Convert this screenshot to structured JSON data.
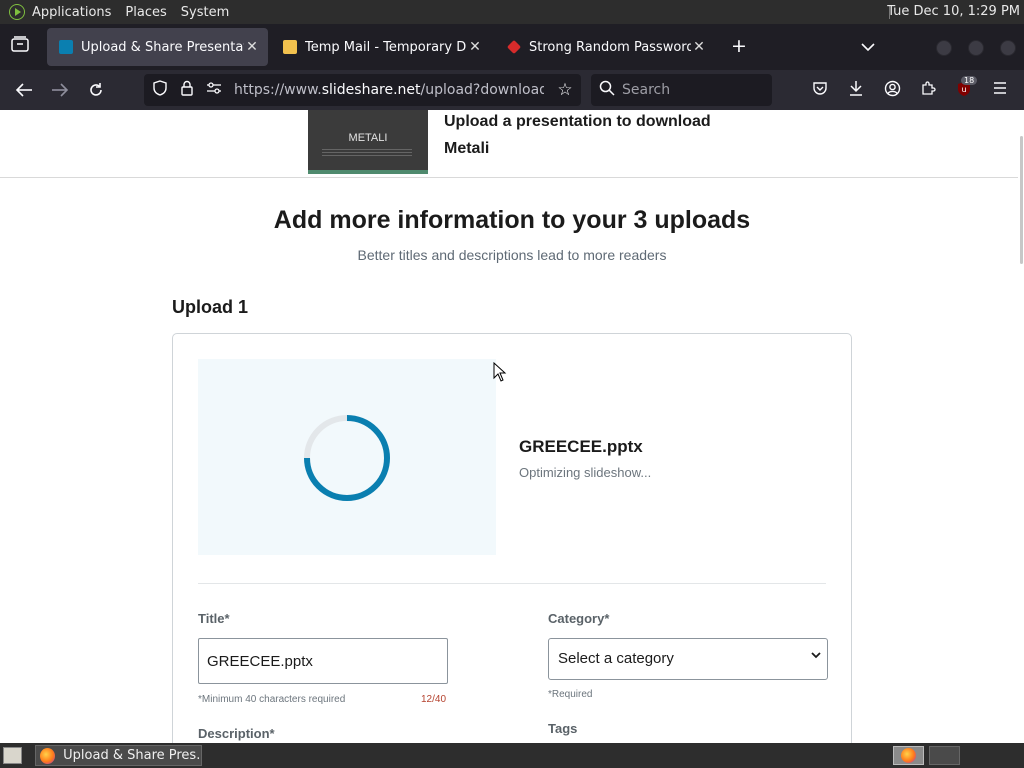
{
  "system_panel": {
    "menus": [
      "Applications",
      "Places",
      "System"
    ],
    "clock": "Tue Dec 10,  1:29 PM"
  },
  "browser": {
    "tabs": [
      {
        "title": "Upload & Share Presentatio",
        "active": true,
        "favicon_color": "#0a7fb0"
      },
      {
        "title": "Temp Mail - Temporary Disp",
        "active": false,
        "favicon_color": "#f2c14e"
      },
      {
        "title": "Strong Random Password G",
        "active": false,
        "favicon_color": "#d62b2b"
      }
    ],
    "url_prefix": "https://www.",
    "url_domain": "slideshare.net",
    "url_rest": "/upload?download_id=",
    "search_placeholder": "Search",
    "extension_badge": "18"
  },
  "page": {
    "header_title": "Upload a presentation to download Metali",
    "thumbnail_text": "METALI",
    "heading": "Add more information to your 3 uploads",
    "subheading": "Better titles and descriptions lead to more readers",
    "upload_label": "Upload 1",
    "file_name": "GREECEE.pptx",
    "file_status": "Optimizing slideshow...",
    "form": {
      "title_label": "Title*",
      "title_value": "GREECEE.pptx",
      "title_hint": "*Minimum 40 characters required",
      "char_count": "12/40",
      "category_label": "Category*",
      "category_value": "Select a category",
      "category_hint": "*Required",
      "description_label": "Description*",
      "tags_label": "Tags"
    }
  },
  "taskbar": {
    "window_title": "Upload & Share Pres..."
  },
  "colors": {
    "spinner": "#0a7fb0",
    "char_count_warning": "#b5432f",
    "preview_bg": "#f2f9fc"
  }
}
